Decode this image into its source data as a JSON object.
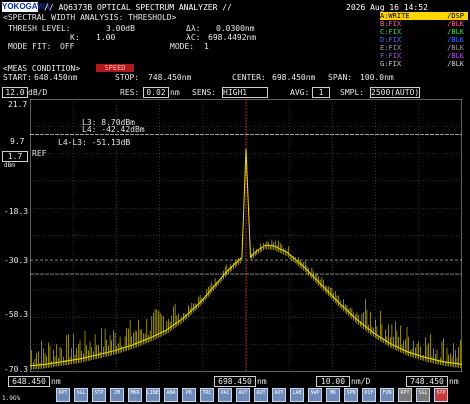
{
  "header": {
    "logo": "YOKOGAWA",
    "title": "// AQ6373B OPTICAL SPECTRUM ANALYZER //",
    "datetime": "2026 Aug 16 14:52"
  },
  "analysis": {
    "heading": "<SPECTRAL WIDTH ANALYSIS: THRESHOLD>",
    "thresh_label": "THRESH LEVEL:",
    "thresh_value": "3.00dB",
    "k_label": "K:",
    "k_value": "1.00",
    "mode_fit_label": "MODE FIT:",
    "mode_fit_value": "OFF",
    "dl_label": "Δλ:",
    "dl_value": "0.0300nm",
    "xc_label": "λC:",
    "xc_value": "698.4492nm",
    "mode_label": "MODE:",
    "mode_value": "1"
  },
  "traces": [
    {
      "left": "A:WRITE",
      "right": "/DSP",
      "color": "#ffd400"
    },
    {
      "left": "B:FIX",
      "right": "/BLK",
      "color": "#ff5aa0"
    },
    {
      "left": "C:FIX",
      "right": "/BLK",
      "color": "#49d34a"
    },
    {
      "left": "D:FIX",
      "right": "/BLK",
      "color": "#3a6cff"
    },
    {
      "left": "E:FIX",
      "right": "/BLK",
      "color": "#9a9a9a"
    },
    {
      "left": "F:FIX",
      "right": "/BLK",
      "color": "#b04ad8"
    },
    {
      "left": "G:FIX",
      "right": "/BLK",
      "color": "#c8c8c8"
    }
  ],
  "meas": {
    "heading": "<MEAS CONDITION>",
    "badge": "SPEED",
    "start_label": "START:",
    "start_value": "648.450nm",
    "stop_label": "STOP:",
    "stop_value": "748.450nm",
    "center_label": "CENTER:",
    "center_value": "698.450nm",
    "span_label": "SPAN:",
    "span_value": "100.0nm"
  },
  "settings": {
    "scale_value": "12.0",
    "scale_unit": "dB/D",
    "res_label": "RES:",
    "res_value": "0.02",
    "res_unit": "nm",
    "sens_label": "SENS:",
    "sens_value": "HIGH1",
    "avg_label": "AVG:",
    "avg_value": "1",
    "smpl_label": "SMPL:",
    "smpl_value": "2500(AUTO)"
  },
  "chart_data": {
    "type": "line",
    "ylim": [
      -78.3,
      21.7
    ],
    "xlim": [
      648.45,
      748.45
    ],
    "y_ticks": [
      "21.7",
      "9.7",
      "-18.3",
      "-30.3",
      "-58.3",
      "-70.3"
    ],
    "ylabel": "dBm",
    "ref_label": "REF",
    "ref_value": "1.7",
    "x": [
      648.45,
      652.0,
      656.0,
      660.0,
      664.0,
      668.0,
      672.0,
      676.0,
      680.0,
      684.0,
      688.0,
      691.0,
      694.0,
      696.0,
      697.5,
      698.45,
      699.5,
      701.0,
      703.0,
      705.0,
      708.0,
      712.0,
      716.0,
      720.0,
      724.0,
      728.0,
      732.0,
      736.0,
      740.0,
      744.0,
      748.45
    ],
    "y": [
      -76.0,
      -75.5,
      -74.5,
      -73.5,
      -72.0,
      -70.5,
      -68.5,
      -66.0,
      -63.0,
      -58.5,
      -52.5,
      -47.0,
      -41.5,
      -38.5,
      -36.5,
      3.5,
      -36.2,
      -33.8,
      -31.8,
      -32.2,
      -34.5,
      -40.0,
      -46.5,
      -53.0,
      -59.0,
      -64.0,
      -68.0,
      -71.0,
      -73.0,
      -74.5,
      -75.5
    ],
    "series_color": "#f0e000",
    "markers": {
      "l3": "L3:     8.70dBm",
      "l4": "L4:   -42.42dBm",
      "diff": "L4-L3:  -51.13dB"
    },
    "marker_line_levels_dbm": [
      8.7,
      -42.42,
      -37.3
    ],
    "cursor_x_nm": 698.45
  },
  "bottom": {
    "start": "648.450",
    "start_unit": "nm",
    "center": "698.450",
    "center_unit": "nm",
    "span_div": "10.00",
    "span_div_unit": "nm/D",
    "stop": "748.450",
    "stop_unit": "nm"
  },
  "toolbar": {
    "page_label": "1.9G%",
    "buttons": [
      "RPT",
      "SGL",
      "STP",
      "ZM",
      "MKR",
      "LINE",
      "ANA",
      "PK",
      "TRC",
      "VAC",
      "AUT",
      "AUT",
      "AUT",
      "LAB",
      "SWP",
      "MK",
      "SPN",
      "DIF",
      "FUN",
      "RPT",
      "SGL",
      "STP"
    ]
  }
}
